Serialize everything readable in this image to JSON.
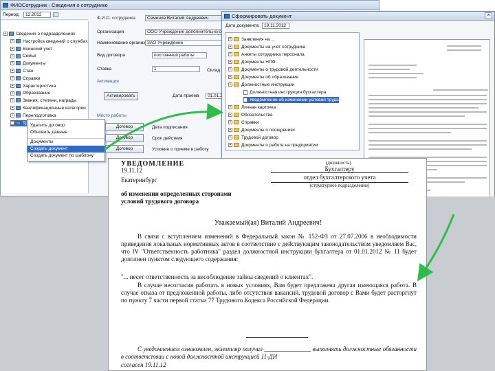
{
  "main_window": {
    "title": "ФИОСотрудник - Сведения о сотруднике",
    "toolbar": {
      "period_label": "Период:",
      "period_value": "12.2012"
    },
    "tree": [
      "Сведения о подразделениях",
      "Настройка сведений о службах",
      "Воинский учет",
      "Семья",
      "Документы",
      "Стаж",
      "Справки",
      "Характеристика",
      "Образование",
      "Звания, степени, награды",
      "Квалификационные категории",
      "Переподготовка",
      "Трудовой договор"
    ],
    "context_menu": [
      "Удалить договор",
      "Обновить данные",
      "Документы",
      "Создать документ",
      "Создать документ по шаблону"
    ],
    "form": {
      "fio_label": "Ф.И.О. сотрудника",
      "fio_value": "Семенов Виталий Андреевич",
      "org_label": "Организация",
      "org_value": "ООО Учреждение дополнительного образования",
      "dept_label": "Наименование организации",
      "dept_value": "ЗАО Учреждение",
      "kind_label": "Вид договора",
      "kind_value": "постоянной работы",
      "rate_label": "Ставка",
      "rate_value": "1",
      "salary_label": "Оклад",
      "section_label": "Активация",
      "date_label": "Дата приема",
      "date_value": "01.01.2012",
      "activate_button": "Активировать",
      "work_section": "Место работы"
    },
    "side_buttons": [
      "Договор",
      "Договор",
      "Договор"
    ],
    "side_labels": [
      "Дата подписания",
      "Срок действия",
      "Условие о приеме в работу"
    ]
  },
  "dialog": {
    "title": "Сформировать документ",
    "date_label": "Дата документа:",
    "date_value": "19.11.2012",
    "tree": [
      "Заявления на ... ",
      "Документы на учет сотрудника",
      "Анкеты сотрудника персонала",
      "Документы НПФ",
      "Документы о трудовой деятельности",
      "Документы об образовании",
      "Должностные инструкции",
      "Должностная инструкция бухгалтера",
      "Уведомление об изменении условий труда",
      "Личная карточка",
      "Обязательства",
      "Справки",
      "Документы о поощрениях",
      "Трудовой договор",
      "Документы о работе на предприятии"
    ],
    "ok_button": "ОК"
  },
  "document": {
    "heading": "УВЕДОМЛЕНИЕ",
    "date_line": "19.11.12",
    "place_line": "Екатеринбург",
    "position_line": "Бухгалтеру",
    "right_caption": "(должность)",
    "right_line": "отдел бухгалтерского учета",
    "right_caption_2": "(структурное подразделение)",
    "subject_1": "об изменении определенных сторонами",
    "subject_2": "условий трудового договора",
    "greeting": "Уважаемый(ая) Виталий Андреевич!",
    "para_1": "В связи с вступлением изменений в Федеральный закон № 152-ФЗ от 27.07.2006 в необходимости приведения локальных нормативных актов в соответствие с действующим законодательством уведомляем Вас, что IV \"Ответственность работника\" раздел должностной инструкции бухгалтера от 01.01.2012 № 11 будет дополнен пунктом следующего содержания:",
    "para_2": "\"... несет ответственность за несоблюдение тайны сведений о клиентах\".",
    "para_3": "В случае несогласия работать в новых условиях, Вам будет предложена другая имеющаяся работа. В случае отказа от предложенной работы, либо отсутствия вакансий, трудовой договор с Вами будет расторгнут по пункту 7 части первой статьи 77 Трудового Кодекса Российской Федерации.",
    "footer": "С уведомлением ознакомлен, экземпляр получил _______________ выполнять должностные обязанности в соответствии с новой должностной инструкцией 11-ДИ",
    "footer_date": "согласен 19.11.12"
  },
  "colors": {
    "arrow": "#2dbd4a",
    "selection": "#316ac5",
    "gray_overlay": "#c9ccd1"
  }
}
